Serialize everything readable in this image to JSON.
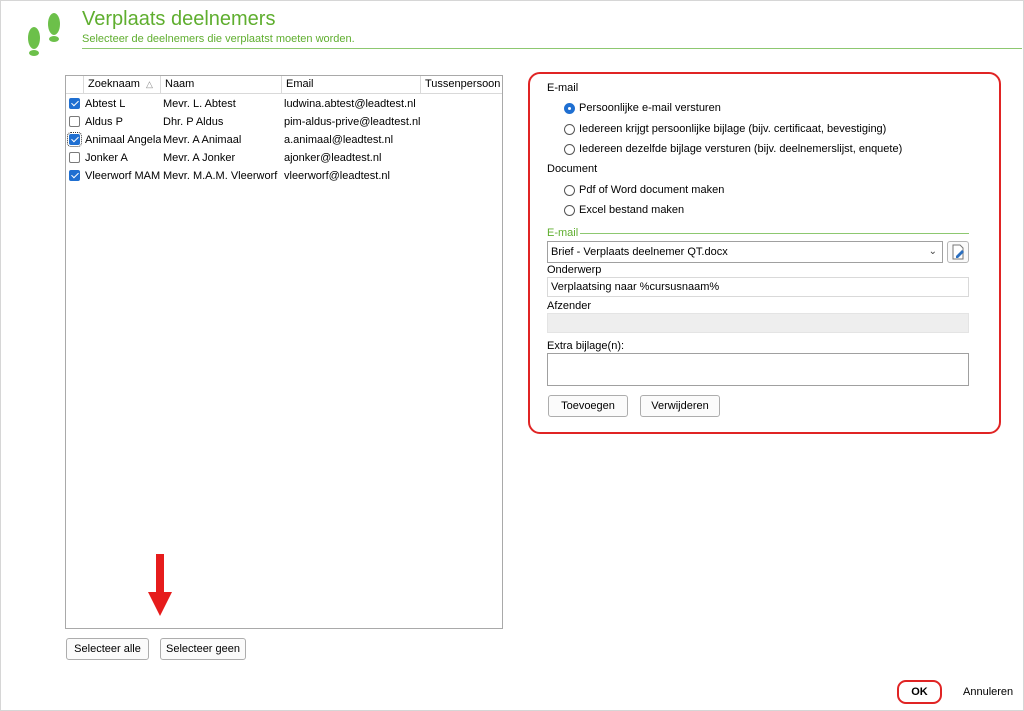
{
  "header": {
    "title": "Verplaats deelnemers",
    "subtitle": "Selecteer de deelnemers die verplaatst moeten worden.",
    "accent": "#5fae2f"
  },
  "grid": {
    "columns": [
      "Zoeknaam",
      "Naam",
      "Email",
      "Tussenpersoon"
    ],
    "sort_indicator": "△",
    "rows": [
      {
        "checked": true,
        "zoeknaam": "Abtest L",
        "naam": "Mevr. L. Abtest",
        "email": "ludwina.abtest@leadtest.nl"
      },
      {
        "checked": false,
        "zoeknaam": "Aldus P",
        "naam": "Dhr. P Aldus",
        "email": "pim-aldus-prive@leadtest.nl"
      },
      {
        "checked": true,
        "zoeknaam": "Animaal Angela",
        "naam": "Mevr. A Animaal",
        "email": "a.animaal@leadtest.nl"
      },
      {
        "checked": false,
        "zoeknaam": "Jonker A",
        "naam": "Mevr. A Jonker",
        "email": "ajonker@leadtest.nl"
      },
      {
        "checked": true,
        "zoeknaam": "Vleerworf MAM",
        "naam": "Mevr. M.A.M. Vleerworf",
        "email": "vleerworf@leadtest.nl"
      }
    ]
  },
  "buttons": {
    "select_all": "Selecteer alle",
    "select_none": "Selecteer geen",
    "ok": "OK",
    "cancel": "Annuleren",
    "add": "Toevoegen",
    "remove": "Verwijderen"
  },
  "options": {
    "email_label": "E-mail",
    "email_options": [
      "Persoonlijke e-mail versturen",
      "Iedereen krijgt persoonlijke bijlage (bijv. certificaat, bevestiging)",
      "Iedereen dezelfde bijlage versturen (bijv. deelnemerslijst, enquete)"
    ],
    "email_selected": 0,
    "document_label": "Document",
    "document_options": [
      "Pdf of Word document maken",
      "Excel bestand maken"
    ]
  },
  "email_section": {
    "label": "E-mail",
    "template": "Brief - Verplaats deelnemer QT.docx",
    "subject_label": "Onderwerp",
    "subject": "Verplaatsing naar %cursusnaam%",
    "sender_label": "Afzender",
    "sender": "",
    "attachments_label": "Extra bijlage(n):"
  },
  "highlight_color": "#e02424",
  "icons": [
    "footsteps-icon",
    "chevron-down-icon",
    "edit-document-icon",
    "arrow-down-icon"
  ]
}
